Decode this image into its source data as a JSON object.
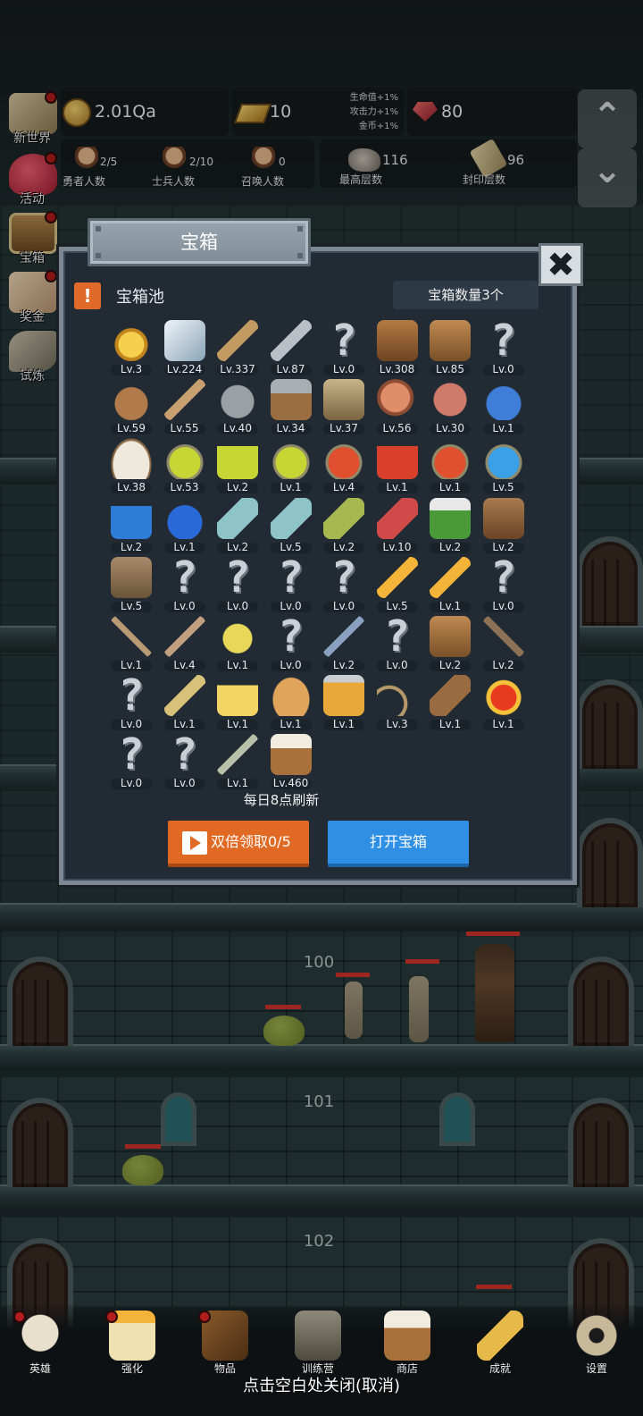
{
  "hud": {
    "gold": "2.01Qa",
    "gold_bars": "10",
    "bonus_lines": [
      "生命值+1%",
      "攻击力+1%",
      "金币+1%"
    ],
    "gems": "80",
    "heroes": {
      "value": "2/5",
      "label": "勇者人数"
    },
    "soldiers": {
      "value": "2/10",
      "label": "士兵人数"
    },
    "summons": {
      "value": "0",
      "label": "召唤人数"
    },
    "max_floor": {
      "value": "116",
      "label": "最高层数"
    },
    "seal_floor": {
      "value": "96",
      "label": "封印层数"
    },
    "arrow_up": "⌃",
    "arrow_down": "⌄"
  },
  "left_menu": [
    {
      "label": "新世界",
      "icon": "map-icon",
      "dot": true
    },
    {
      "label": "活动",
      "icon": "heart-icon",
      "dot": true
    },
    {
      "label": "宝箱",
      "icon": "chest-icon",
      "dot": true
    },
    {
      "label": "奖金",
      "icon": "envelope-icon",
      "dot": true
    },
    {
      "label": "试炼",
      "icon": "scroll-icon",
      "dot": false
    }
  ],
  "floors": [
    "100",
    "101",
    "102"
  ],
  "modal": {
    "title": "宝箱",
    "close": "✖",
    "pool_alert": "!",
    "pool_title": "宝箱池",
    "chest_count": "宝箱数量3个",
    "refresh_note": "每日8点刷新",
    "double_button": "双倍领取0/5",
    "open_button": "打开宝箱",
    "items": [
      {
        "icon": "crown",
        "lv": "Lv.3"
      },
      {
        "icon": "diamond",
        "lv": "Lv.224"
      },
      {
        "icon": "wood-sword",
        "lv": "Lv.337"
      },
      {
        "icon": "steel-sword",
        "lv": "Lv.87"
      },
      {
        "icon": "unknown",
        "lv": "Lv.0"
      },
      {
        "icon": "leather-armor",
        "lv": "Lv.308"
      },
      {
        "icon": "backpack",
        "lv": "Lv.85"
      },
      {
        "icon": "unknown",
        "lv": "Lv.0"
      },
      {
        "icon": "leather-helmet",
        "lv": "Lv.59"
      },
      {
        "icon": "dagger",
        "lv": "Lv.55"
      },
      {
        "icon": "iron-helmet",
        "lv": "Lv.40"
      },
      {
        "icon": "hammer",
        "lv": "Lv.34"
      },
      {
        "icon": "knight-helmet",
        "lv": "Lv.37"
      },
      {
        "icon": "ham",
        "lv": "Lv.56"
      },
      {
        "icon": "steak",
        "lv": "Lv.30"
      },
      {
        "icon": "blue-sack",
        "lv": "Lv.1"
      },
      {
        "icon": "flour-bowl",
        "lv": "Lv.38"
      },
      {
        "icon": "yellow-potion",
        "lv": "Lv.53"
      },
      {
        "icon": "yellow-flask",
        "lv": "Lv.2"
      },
      {
        "icon": "yellow-potion",
        "lv": "Lv.1"
      },
      {
        "icon": "red-potion",
        "lv": "Lv.4"
      },
      {
        "icon": "red-flask",
        "lv": "Lv.1"
      },
      {
        "icon": "red-potion",
        "lv": "Lv.1"
      },
      {
        "icon": "blue-potion",
        "lv": "Lv.5"
      },
      {
        "icon": "blue-flask",
        "lv": "Lv.2"
      },
      {
        "icon": "blue-round-potion",
        "lv": "Lv.1"
      },
      {
        "icon": "vial",
        "lv": "Lv.2"
      },
      {
        "icon": "vial",
        "lv": "Lv.5"
      },
      {
        "icon": "green-bottle",
        "lv": "Lv.2"
      },
      {
        "icon": "red-bottle",
        "lv": "Lv.10"
      },
      {
        "icon": "winged-boot",
        "lv": "Lv.2"
      },
      {
        "icon": "leather-boot",
        "lv": "Lv.2"
      },
      {
        "icon": "shoe",
        "lv": "Lv.5"
      },
      {
        "icon": "unknown",
        "lv": "Lv.0"
      },
      {
        "icon": "unknown",
        "lv": "Lv.0"
      },
      {
        "icon": "unknown",
        "lv": "Lv.0"
      },
      {
        "icon": "unknown",
        "lv": "Lv.0"
      },
      {
        "icon": "torch",
        "lv": "Lv.5"
      },
      {
        "icon": "torch",
        "lv": "Lv.1"
      },
      {
        "icon": "unknown",
        "lv": "Lv.0"
      },
      {
        "icon": "pickaxe",
        "lv": "Lv.1"
      },
      {
        "icon": "staff",
        "lv": "Lv.4"
      },
      {
        "icon": "lemons",
        "lv": "Lv.1"
      },
      {
        "icon": "unknown",
        "lv": "Lv.0"
      },
      {
        "icon": "blue-scepter",
        "lv": "Lv.2"
      },
      {
        "icon": "unknown",
        "lv": "Lv.0"
      },
      {
        "icon": "backpack",
        "lv": "Lv.2"
      },
      {
        "icon": "shovel",
        "lv": "Lv.2"
      },
      {
        "icon": "unknown",
        "lv": "Lv.0"
      },
      {
        "icon": "broom",
        "lv": "Lv.1"
      },
      {
        "icon": "cheese",
        "lv": "Lv.1"
      },
      {
        "icon": "pie",
        "lv": "Lv.1"
      },
      {
        "icon": "honey-jar",
        "lv": "Lv.1"
      },
      {
        "icon": "bow",
        "lv": "Lv.3"
      },
      {
        "icon": "quiver",
        "lv": "Lv.1"
      },
      {
        "icon": "fire-gauntlet",
        "lv": "Lv.1"
      },
      {
        "icon": "unknown",
        "lv": "Lv.0"
      },
      {
        "icon": "unknown",
        "lv": "Lv.0"
      },
      {
        "icon": "green-wand",
        "lv": "Lv.1"
      },
      {
        "icon": "beer-mug",
        "lv": "Lv.460"
      }
    ]
  },
  "bottom_nav": [
    {
      "label": "英雄",
      "icon": "skull-icon",
      "dot": true
    },
    {
      "label": "强化",
      "icon": "candle-icon",
      "dot": true
    },
    {
      "label": "物品",
      "icon": "book-icon",
      "dot": true
    },
    {
      "label": "训练营",
      "icon": "lantern-icon",
      "dot": false
    },
    {
      "label": "商店",
      "icon": "mug-icon",
      "dot": false
    },
    {
      "label": "成就",
      "icon": "key-icon",
      "dot": false
    },
    {
      "label": "设置",
      "icon": "gear-icon",
      "dot": false
    }
  ],
  "close_hint": "点击空白处关闭(取消)"
}
